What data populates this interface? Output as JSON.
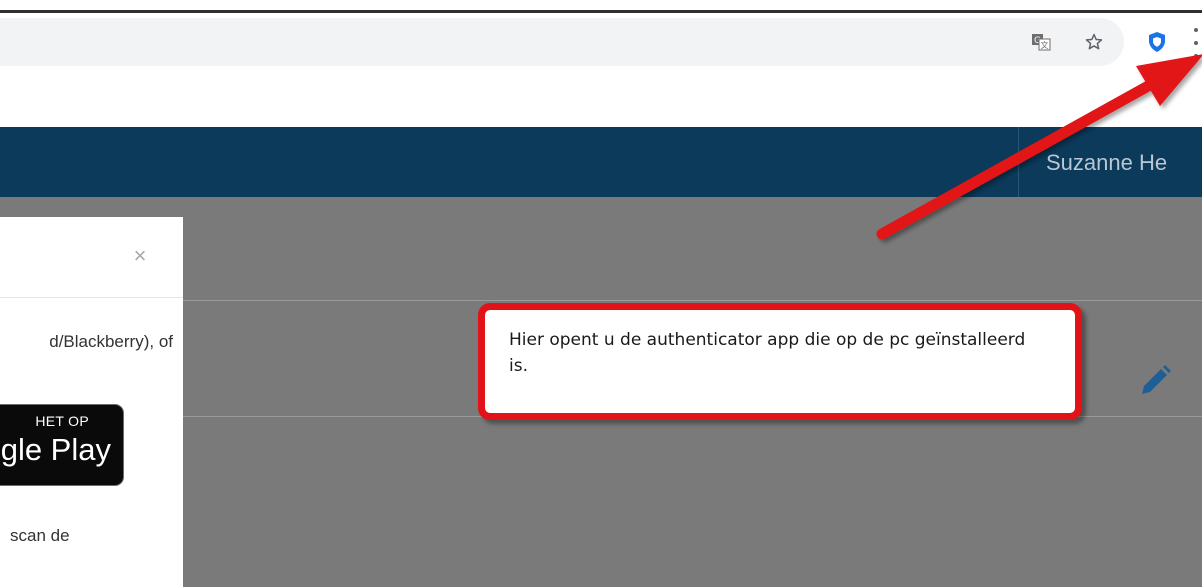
{
  "browser": {
    "toolbar": {
      "translate_icon": "translate-icon",
      "bookmark_icon": "star-icon",
      "extension_icon": "shield-icon",
      "menu_icon": "kebab-menu-icon"
    }
  },
  "app": {
    "user_name": "Suzanne He",
    "edit_icon": "pencil-icon"
  },
  "modal": {
    "close_label": "×",
    "text_line1": "d/Blackberry), of",
    "store_badge": {
      "top": "HET OP",
      "main": "gle Play"
    },
    "text_line2": "scan de"
  },
  "callout": {
    "text": "Hier opent u de authenticator app die op de pc geïnstalleerd is."
  },
  "colors": {
    "appbar": "#0b3a5b",
    "overlay": "#7a7a7a",
    "callout_border": "#e21219",
    "arrow": "#e21219",
    "edit_icon": "#1f5f95"
  }
}
